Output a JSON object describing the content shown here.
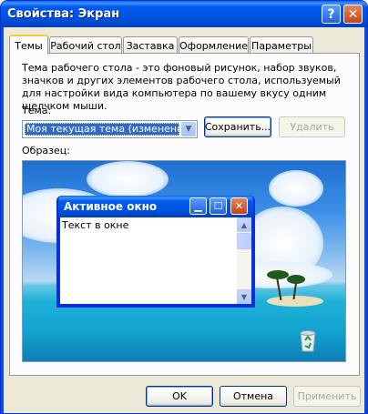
{
  "window": {
    "title": "Свойства: Экран",
    "help_glyph": "?",
    "close_glyph": "✕"
  },
  "tabs": [
    {
      "label": "Темы",
      "active": true
    },
    {
      "label": "Рабочий стол",
      "active": false
    },
    {
      "label": "Заставка",
      "active": false
    },
    {
      "label": "Оформление",
      "active": false
    },
    {
      "label": "Параметры",
      "active": false
    }
  ],
  "themes": {
    "description": "Тема рабочего стола - это фоновый рисунок, набор звуков, значков и других элементов рабочего стола, используемый для настройки вида компьютера по вашему вкусу одним щелчком мыши.",
    "theme_label": "Тема:",
    "selected_theme": "Моя текущая тема (изменено)",
    "save_button": "Сохранить...",
    "delete_button": "Удалить",
    "sample_label": "Образец:"
  },
  "preview": {
    "window_title": "Активное окно",
    "window_text": "Текст в окне",
    "recycle_bin_icon": "recycle-bin-icon"
  },
  "footer": {
    "ok": "OK",
    "cancel": "Отмена",
    "apply": "Применить"
  },
  "colors": {
    "titlebar": "#0054e3",
    "dialog_bg": "#ece9d8",
    "active_tab_accent": "#ffc83c",
    "selection": "#316ac5"
  }
}
